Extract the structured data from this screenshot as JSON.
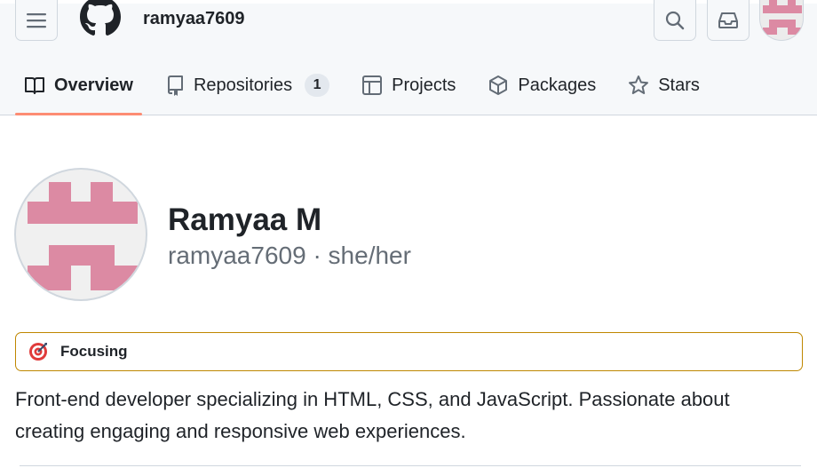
{
  "header": {
    "username": "ramyaa7609"
  },
  "tabs": [
    {
      "label": "Overview",
      "icon": "book-icon",
      "active": true
    },
    {
      "label": "Repositories",
      "icon": "repo-icon",
      "count": "1"
    },
    {
      "label": "Projects",
      "icon": "table-icon"
    },
    {
      "label": "Packages",
      "icon": "package-icon"
    },
    {
      "label": "Stars",
      "icon": "star-icon"
    }
  ],
  "profile": {
    "name": "Ramyaa M",
    "login": "ramyaa7609",
    "separator": "·",
    "pronouns": "she/her"
  },
  "status": {
    "emoji": "dart-icon",
    "text": "Focusing"
  },
  "bio": "Front-end developer specializing in HTML, CSS, and JavaScript. Passionate about creating engaging and responsive web experiences.",
  "colors": {
    "avatar_pink": "#dc8aa3",
    "tab_underline": "#fd8c73",
    "status_border": "#bf8700"
  }
}
